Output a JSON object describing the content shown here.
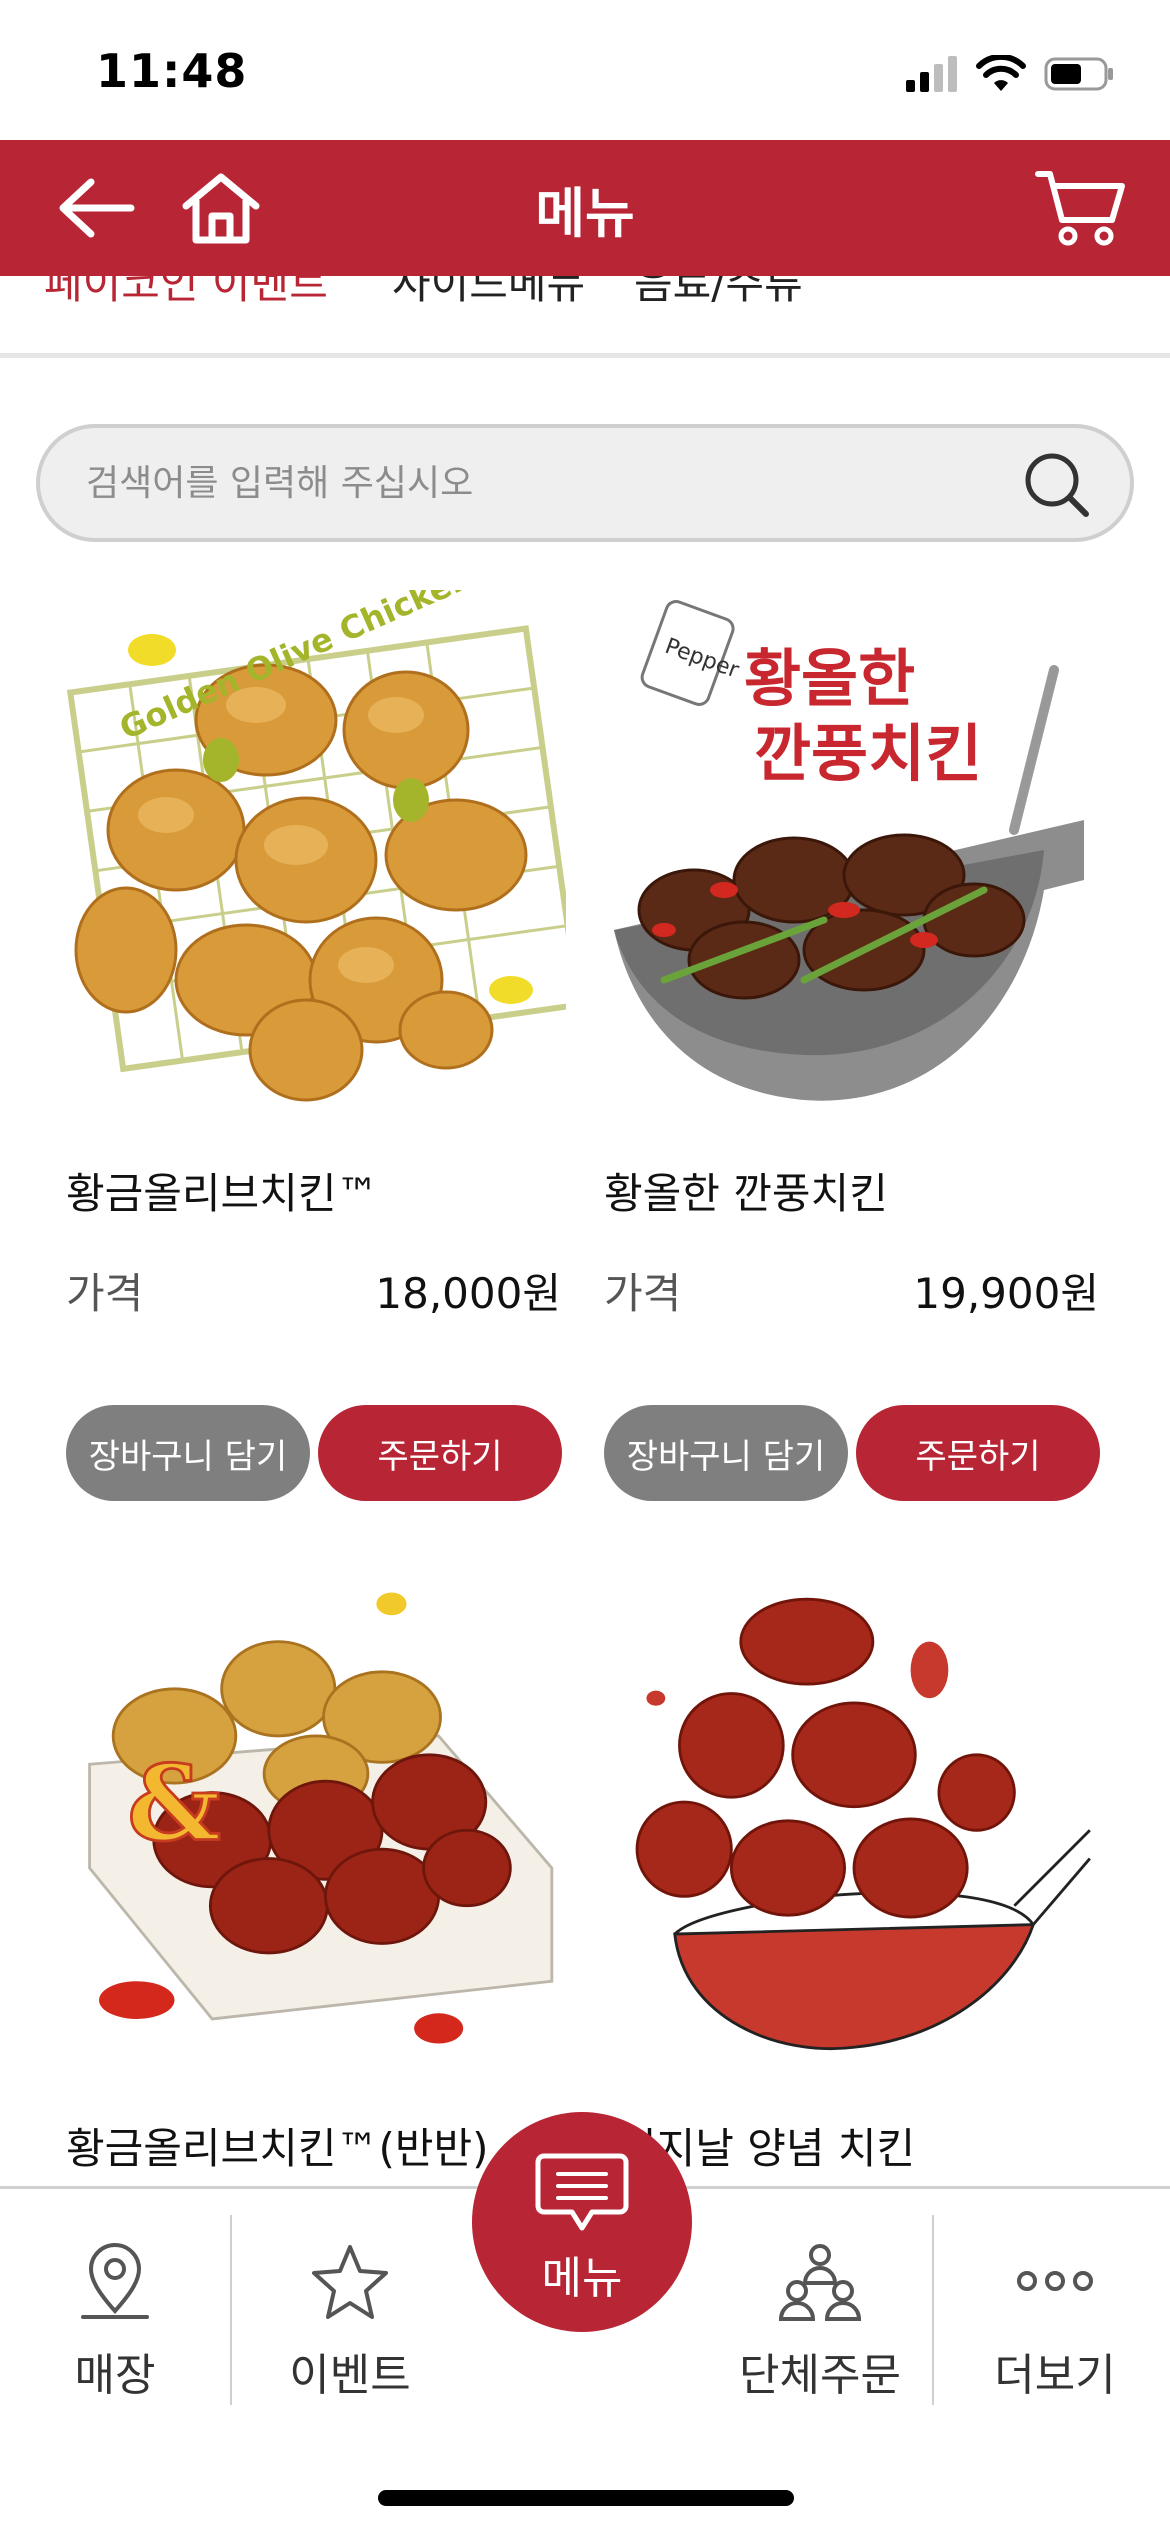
{
  "status_bar": {
    "time": "11:48"
  },
  "header": {
    "title": "메뉴",
    "back_icon": "back-arrow-icon",
    "home_icon": "home-icon",
    "cart_icon": "cart-icon"
  },
  "tabs": [
    {
      "label": "페이코인 이벤트",
      "active": true
    },
    {
      "label": "사이드메뉴",
      "active": false
    },
    {
      "label": "음료/주류",
      "active": false
    }
  ],
  "search": {
    "placeholder": "검색어를 입력해 주십시오",
    "value": ""
  },
  "products": [
    {
      "name": "황금올리브치킨™",
      "price_label": "가격",
      "price": "18,000원",
      "image_caption": "Golden Olive Chicken",
      "add_to_cart": "장바구니 담기",
      "order": "주문하기"
    },
    {
      "name": "황올한 깐풍치킨",
      "price_label": "가격",
      "price": "19,900원",
      "image_caption": "황올한 깐풍치킨",
      "image_caption_2": "Pepper",
      "add_to_cart": "장바구니 담기",
      "order": "주문하기"
    },
    {
      "name": "황금올리브치킨™(반반)",
      "image_caption": "&"
    },
    {
      "name": "리지날 양념 치킨"
    }
  ],
  "bottom_nav": {
    "items": [
      {
        "label": "매장",
        "icon": "location-pin-icon"
      },
      {
        "label": "이벤트",
        "icon": "star-icon"
      },
      {
        "label": "단체주문",
        "icon": "group-icon"
      },
      {
        "label": "더보기",
        "icon": "more-dots-icon"
      }
    ],
    "center": {
      "label": "메뉴",
      "icon": "chat-bubble-icon"
    }
  },
  "colors": {
    "brand": "#b82535",
    "gray_button": "#7f7f7f"
  }
}
